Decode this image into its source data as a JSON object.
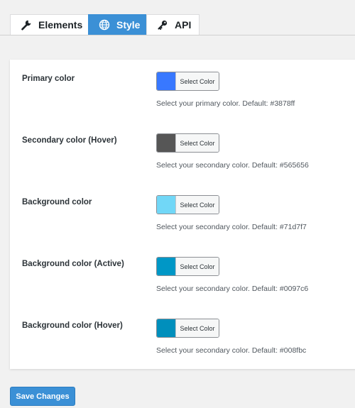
{
  "tabs": [
    {
      "label": "Elements",
      "icon": "wrench-icon",
      "active": false
    },
    {
      "label": "Style",
      "icon": "globe-icon",
      "active": true
    },
    {
      "label": "API",
      "icon": "key-icon",
      "active": false
    }
  ],
  "settings": [
    {
      "label": "Primary color",
      "button": "Select Color",
      "swatch": "#3878ff",
      "description": "Select your primary color. Default: #3878ff"
    },
    {
      "label": "Secondary color (Hover)",
      "button": "Select Color",
      "swatch": "#565656",
      "description": "Select your secondary color. Default: #565656"
    },
    {
      "label": "Background color",
      "button": "Select Color",
      "swatch": "#71d7f7",
      "description": "Select your secondary color. Default: #71d7f7"
    },
    {
      "label": "Background color (Active)",
      "button": "Select Color",
      "swatch": "#0097c6",
      "description": "Select your secondary color. Default: #0097c6"
    },
    {
      "label": "Background color (Hover)",
      "button": "Select Color",
      "swatch": "#008fbc",
      "description": "Select your secondary color. Default: #008fbc"
    }
  ],
  "save_label": "Save Changes",
  "accent": "#3b90d6"
}
